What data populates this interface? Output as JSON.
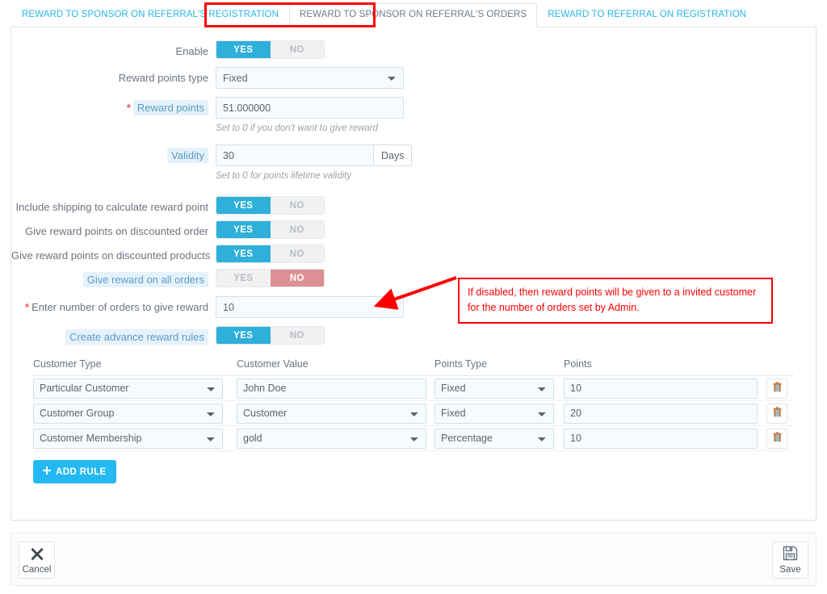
{
  "tabs": [
    {
      "label": "REWARD TO SPONSOR ON REFERRAL'S REGISTRATION",
      "active": false
    },
    {
      "label": "REWARD TO SPONSOR ON REFERRAL'S ORDERS",
      "active": true
    },
    {
      "label": "REWARD TO REFERRAL ON REGISTRATION",
      "active": false
    }
  ],
  "form": {
    "enable": {
      "label": "Enable",
      "yes": "YES",
      "no": "NO",
      "value": "YES"
    },
    "reward_points_type": {
      "label": "Reward points type",
      "value": "Fixed",
      "options": [
        "Fixed",
        "Percentage"
      ]
    },
    "reward_points": {
      "label": "Reward points",
      "required": "*",
      "value": "51.000000",
      "hint": "Set to 0 if you don't want to give reward"
    },
    "validity": {
      "label": "Validity",
      "value": "30",
      "addon": "Days",
      "hint": "Set to 0 for points lifetime validity"
    },
    "include_shipping": {
      "label": "Include shipping to calculate reward point",
      "yes": "YES",
      "no": "NO",
      "value": "YES"
    },
    "discounted_order": {
      "label": "Give reward points on discounted order",
      "yes": "YES",
      "no": "NO",
      "value": "YES"
    },
    "discounted_products": {
      "label": "Give reward points on discounted products",
      "yes": "YES",
      "no": "NO",
      "value": "YES"
    },
    "all_orders": {
      "label": "Give reward on all orders",
      "yes": "YES",
      "no": "NO",
      "value": "NO"
    },
    "number_of_orders": {
      "label": "Enter number of orders to give reward",
      "required": "*",
      "value": "10"
    },
    "advance_rules": {
      "label": "Create advance reward rules",
      "yes": "YES",
      "no": "NO",
      "value": "YES"
    }
  },
  "annotation": {
    "text": "If disabled, then reward points will be given to a invited customer for the number of orders set by Admin.",
    "color": "#ff0000"
  },
  "rules_table": {
    "headers": [
      "Customer Type",
      "Customer Value",
      "Points Type",
      "Points"
    ],
    "rows": [
      {
        "customer_type": "Particular Customer",
        "customer_value": "John Doe",
        "value_is_select": false,
        "points_type": "Fixed",
        "points": "10"
      },
      {
        "customer_type": "Customer Group",
        "customer_value": "Customer",
        "value_is_select": true,
        "points_type": "Fixed",
        "points": "20"
      },
      {
        "customer_type": "Customer Membership",
        "customer_value": "gold",
        "value_is_select": true,
        "points_type": "Percentage",
        "points": "10"
      }
    ],
    "customer_type_options": [
      "Particular Customer",
      "Customer Group",
      "Customer Membership"
    ],
    "points_type_options": [
      "Fixed",
      "Percentage"
    ],
    "add_rule_label": "ADD RULE",
    "add_rule_icon": "plus-icon",
    "delete_icon": "trash-icon"
  },
  "footer": {
    "cancel_label": "Cancel",
    "cancel_icon": "close-x-icon",
    "save_label": "Save",
    "save_icon": "floppy-disk-icon"
  },
  "colors": {
    "accent": "#2eb0da",
    "accent_button": "#25b9f3",
    "no_toggle": "#dd8f93",
    "required": "#ff5454",
    "annotation": "#ff0000",
    "tab_link": "#29b6e8"
  }
}
